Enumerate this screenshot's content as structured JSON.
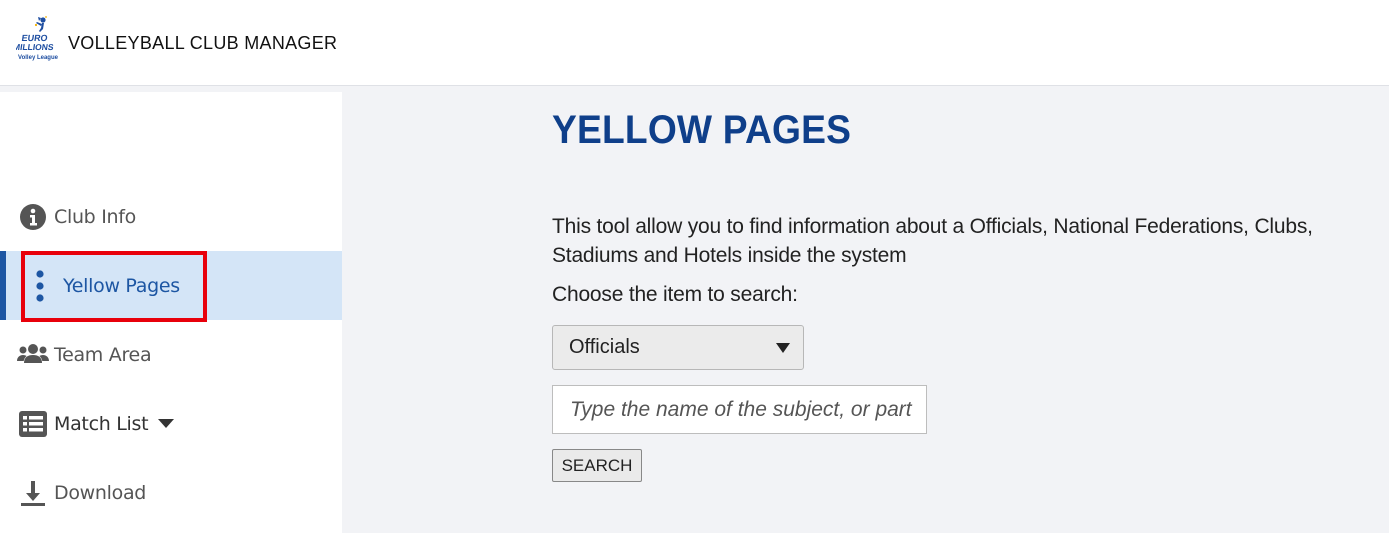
{
  "header": {
    "logo_alt": "Euro Millions Volley League",
    "app_title": "VOLLEYBALL CLUB MANAGER"
  },
  "sidebar": {
    "items": [
      {
        "label": "Club Info",
        "icon": "info-circle-icon",
        "active": false
      },
      {
        "label": "Yellow Pages",
        "icon": "vertical-dots-icon",
        "active": true
      },
      {
        "label": "Team Area",
        "icon": "users-icon",
        "active": false
      },
      {
        "label": "Match List",
        "icon": "list-icon",
        "active": false,
        "has_dropdown": true
      },
      {
        "label": "Download",
        "icon": "download-icon",
        "active": false
      }
    ]
  },
  "main": {
    "title": "YELLOW PAGES",
    "description": "This tool allow you to find information about a Officials, National Federations, Clubs, Stadiums and Hotels inside the system",
    "choose_label": "Choose the item to search:",
    "select": {
      "selected": "Officials"
    },
    "search_input": {
      "value": "",
      "placeholder": "Type the name of the subject, or part"
    },
    "search_button": "SEARCH"
  },
  "colors": {
    "brand_blue": "#0f3f8a",
    "active_bg": "#d4e5f7",
    "active_text": "#1d56a3",
    "highlight_red": "#e8000b",
    "page_bg": "#f2f3f6"
  }
}
